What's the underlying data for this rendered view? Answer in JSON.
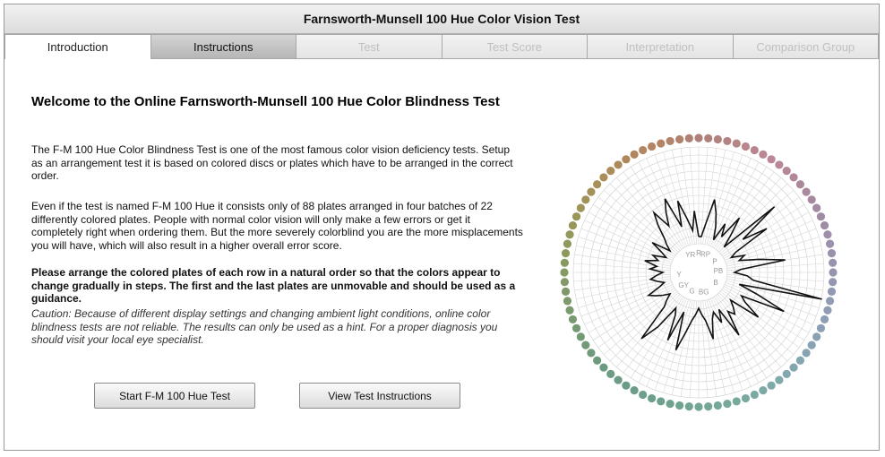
{
  "window": {
    "title": "Farnsworth-Munsell 100 Hue Color Vision Test"
  },
  "tabs": [
    {
      "label": "Introduction",
      "state": "active"
    },
    {
      "label": "Instructions",
      "state": "enabled"
    },
    {
      "label": "Test",
      "state": "disabled"
    },
    {
      "label": "Test Score",
      "state": "disabled"
    },
    {
      "label": "Interpretation",
      "state": "disabled"
    },
    {
      "label": "Comparison Group",
      "state": "disabled"
    }
  ],
  "content": {
    "heading": "Welcome to the Online Farnsworth-Munsell 100 Hue Color Blindness Test",
    "paragraphs": [
      "The F-M 100 Hue Color Blindness Test is one of the most famous color vision deficiency tests. Setup as an arrangement test it is based on colored discs or plates which have to be arranged in the correct order.",
      "Even if the test is named F-M 100 Hue it consists only of 88 plates arranged in four batches of 22 differently colored plates. People with normal color vision will only make a few errors or get it completely right when ordering them. But the more severely colorblind you are the more misplacements you will have, which will also result in a higher overall error score."
    ],
    "instruction": "Please arrange the colored plates of each row in a natural order so that the colors appear to change gradually in steps. The first and the last plates are unmovable and should be used as a guidance.",
    "caution": "Caution: Because of different display settings and changing ambient light conditions, online color blindness tests are not reliable. The results can only be used as a hint. For a proper diagnosis you should visit your local eye specialist."
  },
  "buttons": {
    "start": "Start F-M 100 Hue Test",
    "instructions": "View Test Instructions"
  },
  "hue_chart": {
    "hue_labels": [
      "R",
      "RP",
      "P",
      "PB",
      "B",
      "BG",
      "G",
      "GY",
      "Y",
      "YR"
    ],
    "plate_count": 88,
    "plate_colors": [
      "#ae7f78",
      "#b68588",
      "#bc8797",
      "#ad879a",
      "#a18ba4",
      "#9a91ad",
      "#9299b3",
      "#8c9fb5",
      "#84a6b1",
      "#7eaaa7",
      "#78a99d",
      "#72a694",
      "#6ea18d",
      "#6b9c88",
      "#6e9a7e",
      "#769a72",
      "#80996a",
      "#8c9a5e",
      "#9a9658",
      "#a89058",
      "#b0875c",
      "#b58465",
      "#ae7f78"
    ],
    "error_values": [
      0,
      0,
      2,
      6,
      4,
      2,
      0,
      3,
      1,
      5,
      2,
      0,
      10,
      3,
      7,
      1,
      0,
      2,
      1,
      4,
      8,
      1,
      0,
      2,
      3,
      14,
      1,
      4,
      9,
      2,
      3,
      6,
      1,
      2,
      3,
      2,
      6,
      1,
      3,
      1,
      2,
      5,
      2,
      1,
      0,
      1,
      2,
      4,
      7,
      1,
      6,
      2,
      1,
      5,
      8,
      2,
      1,
      0,
      1,
      2,
      3,
      1,
      0,
      1,
      2,
      1,
      0,
      2,
      1,
      3,
      1,
      2,
      0,
      1,
      3,
      0,
      1,
      2,
      4,
      6,
      3,
      5,
      7,
      2,
      6,
      3,
      1,
      4
    ]
  }
}
